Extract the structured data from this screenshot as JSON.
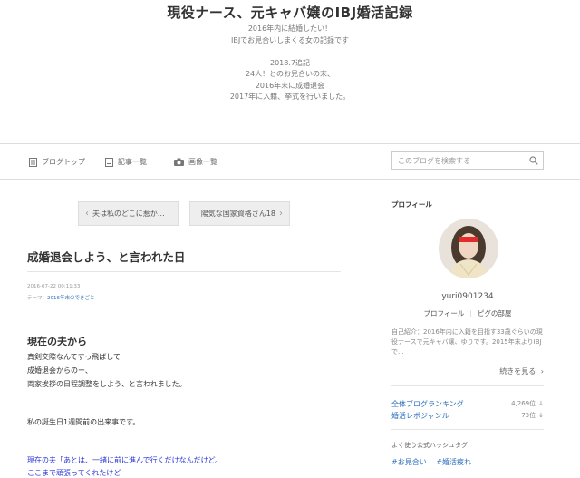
{
  "header": {
    "title": "現役ナース、元キャバ嬢のIBJ婚活記録",
    "description_lines": [
      "2016年内に結婚したい！",
      "IBJでお見合いしまくる女の記録です",
      "",
      "2018.7追記",
      "24人！とのお見合いの末、",
      "2016年末に成婚退会",
      "2017年に入籍、挙式を行いました。"
    ]
  },
  "nav": {
    "items": [
      {
        "label": "ブログトップ",
        "icon": "book-icon"
      },
      {
        "label": "記事一覧",
        "icon": "list-icon"
      },
      {
        "label": "画像一覧",
        "icon": "camera-icon"
      }
    ],
    "search_placeholder": "このブログを検索する"
  },
  "pager": {
    "prev_label": "夫は私のどこに惹か…",
    "next_label": "陽気な国家資格さん18"
  },
  "article": {
    "title": "成婚退会しよう、と言われた日",
    "date": "2016-07-22 00:11:33",
    "theme_prefix": "テーマ：",
    "theme_link": "2016年末のできごと",
    "subheading": "現在の夫から",
    "lines": [
      "真剣交際なんてすっ飛ばして",
      "成婚退会からのー、",
      "両家挨拶の日程調整をしよう、と言われました。",
      "私の誕生日1週間前の出来事です。"
    ],
    "blue_lines": [
      "現在の夫「あとは、一緒に前に進んで行くだけなんだけど。",
      "ここまで頑張ってくれたけど"
    ]
  },
  "sidebar": {
    "profile_label": "プロフィール",
    "username": "yuri0901234",
    "profile_link": "プロフィール",
    "pigg_link": "ピグの部屋",
    "intro": "自己紹介：2016年内に入籍を目指す33歳ぐらいの現役ナースで元キャバ嬢、ゆりです。2015年末よりIBJで...",
    "more_label": "続きを見る",
    "rankings": [
      {
        "name": "全体ブログランキング",
        "value": "4,269位"
      },
      {
        "name": "婚活レポジャンル",
        "value": "73位"
      }
    ],
    "hashtag_label": "よく使う公式ハッシュタグ",
    "hashtags": [
      "#お見合い",
      "#婚活疲れ"
    ]
  },
  "colors": {
    "link_blue": "#2a6ebb",
    "text_blue": "#2b36d8"
  }
}
